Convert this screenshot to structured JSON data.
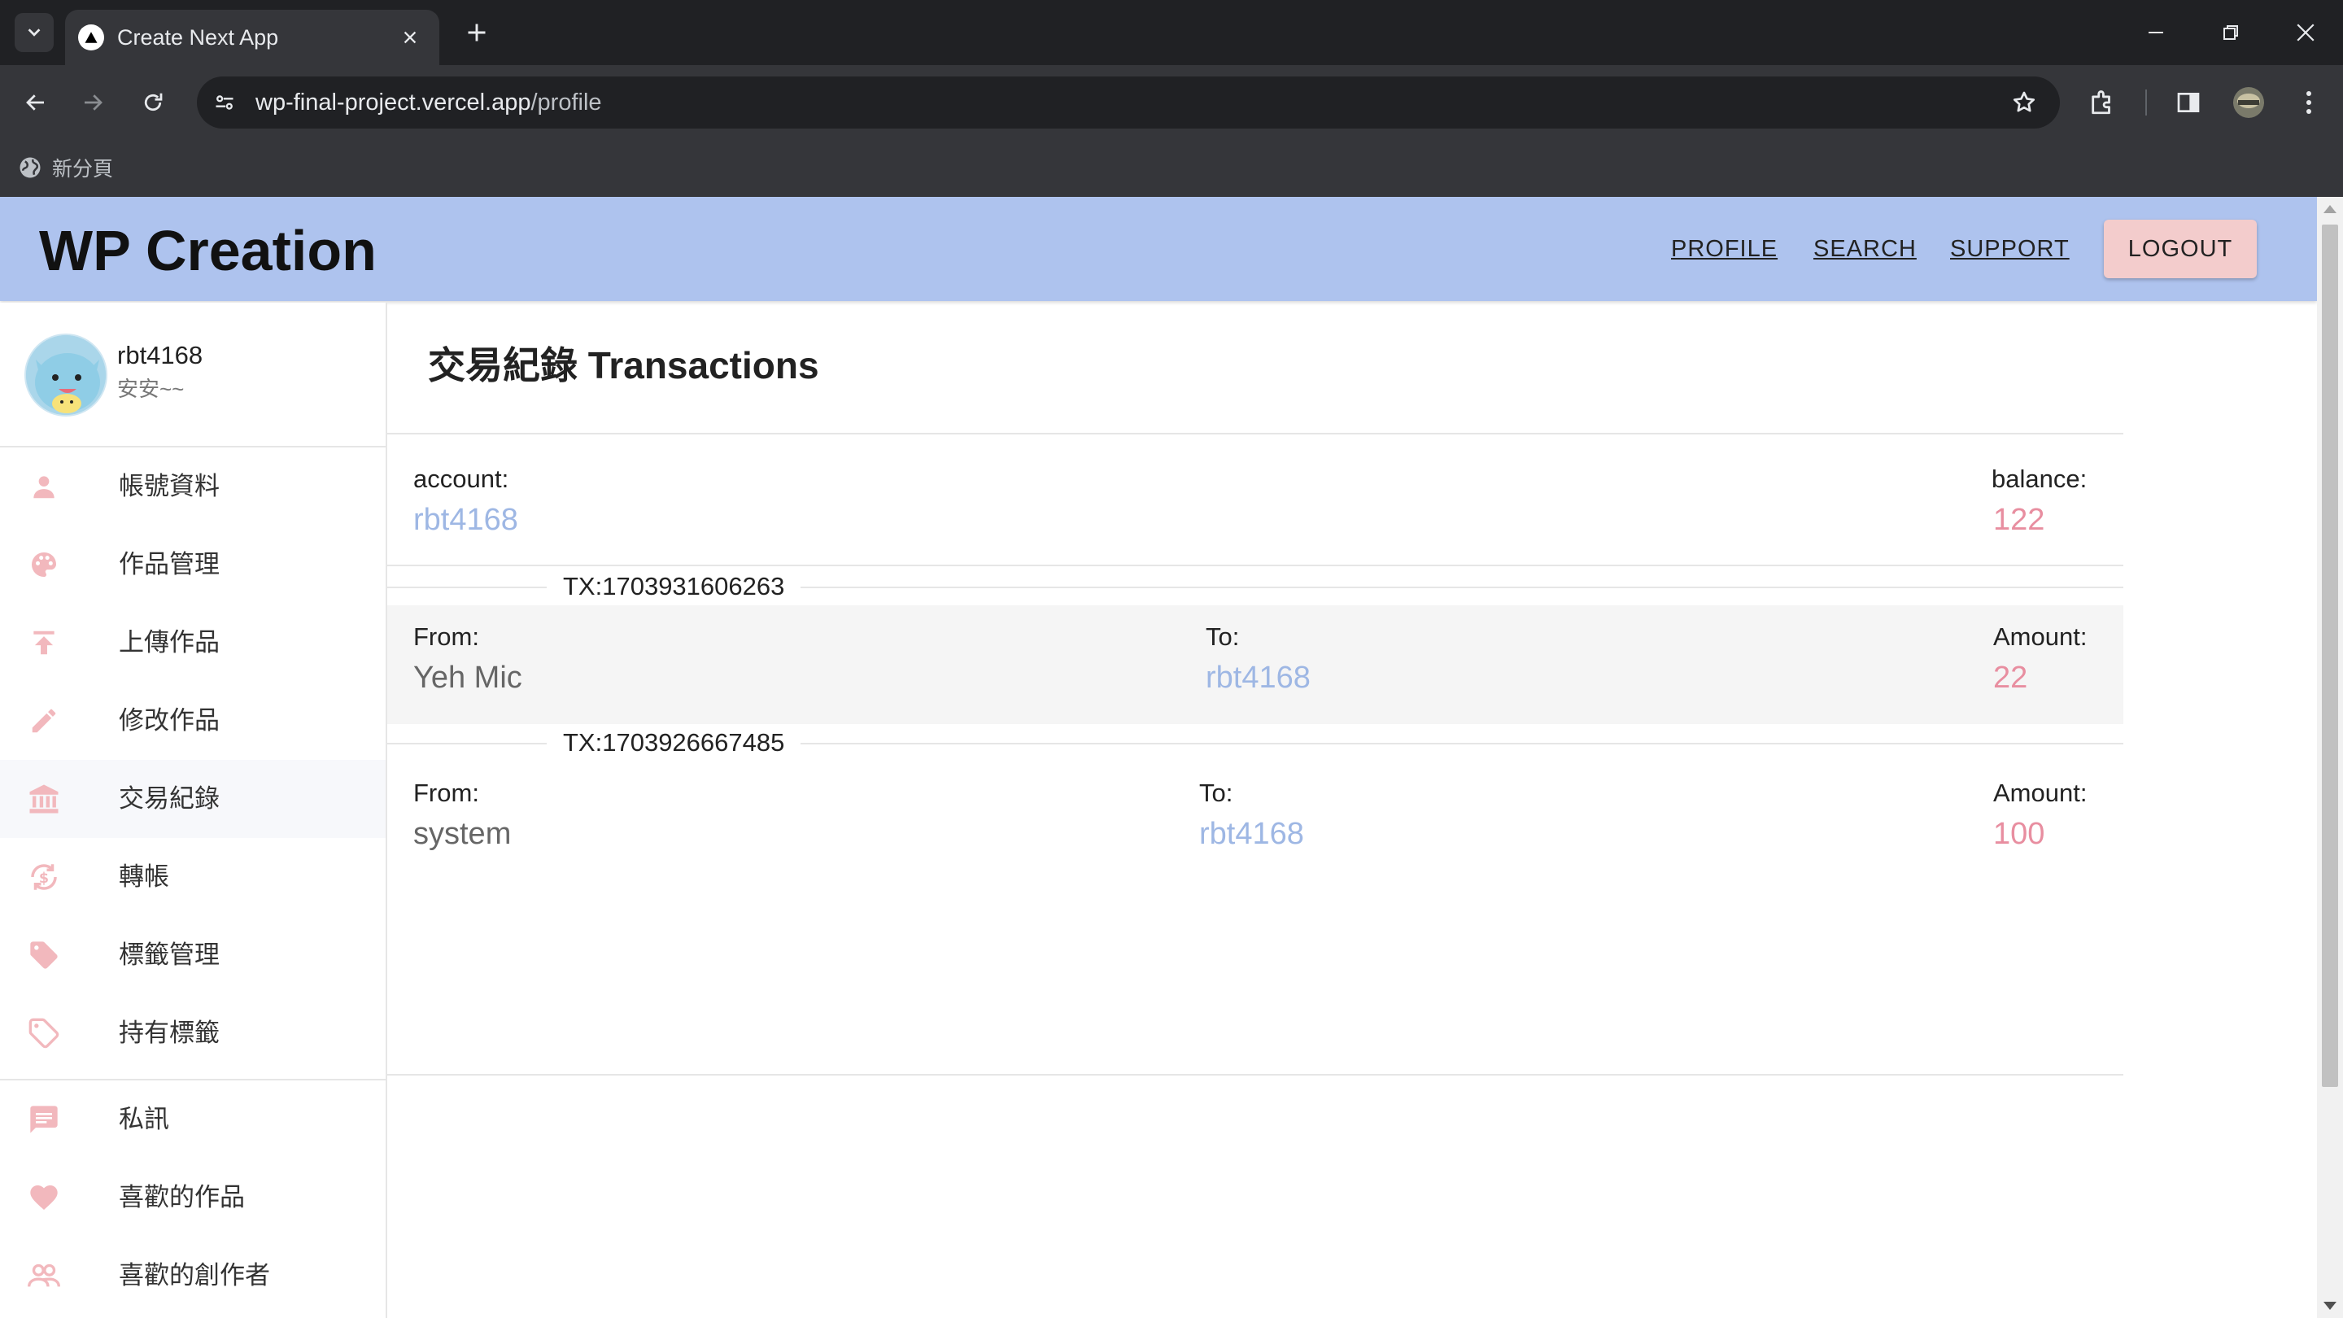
{
  "browser": {
    "tab_title": "Create Next App",
    "url_host": "wp-final-project.vercel.app",
    "url_path": "/profile",
    "bookmark_label": "新分頁"
  },
  "header": {
    "brand": "WP Creation",
    "nav": [
      "PROFILE",
      "SEARCH",
      "SUPPORT"
    ],
    "logout_label": "LOGOUT"
  },
  "user": {
    "name": "rbt4168",
    "motto": "安安~~"
  },
  "sidebar": {
    "items": [
      {
        "label": "帳號資料",
        "icon": "person-icon"
      },
      {
        "label": "作品管理",
        "icon": "palette-icon"
      },
      {
        "label": "上傳作品",
        "icon": "upload-icon"
      },
      {
        "label": "修改作品",
        "icon": "pencil-icon"
      },
      {
        "label": "交易紀錄",
        "icon": "bank-icon",
        "active": true
      },
      {
        "label": "轉帳",
        "icon": "currency-exchange-icon"
      },
      {
        "label": "標籤管理",
        "icon": "tag-icon"
      },
      {
        "label": "持有標籤",
        "icon": "tags-icon"
      },
      {
        "label": "私訊",
        "icon": "chat-icon"
      },
      {
        "label": "喜歡的作品",
        "icon": "heart-icon"
      },
      {
        "label": "喜歡的創作者",
        "icon": "people-icon"
      }
    ]
  },
  "transactions_page": {
    "title": "交易紀錄 Transactions",
    "account_label": "account:",
    "account_value": "rbt4168",
    "balance_label": "balance:",
    "balance_value": "122",
    "transactions": [
      {
        "id": "TX:1703931606263",
        "from_label": "From:",
        "from": "Yeh Mic",
        "to_label": "To:",
        "to": "rbt4168",
        "amount_label": "Amount:",
        "amount": "22"
      },
      {
        "id": "TX:1703926667485",
        "from_label": "From:",
        "from": "system",
        "to_label": "To:",
        "to": "rbt4168",
        "amount_label": "Amount:",
        "amount": "100"
      }
    ]
  },
  "colors": {
    "header_bg": "#aec3ee",
    "logout_bg": "#f3cccc",
    "link_blue": "#9eb7e4",
    "amount_pink": "#e88ea0",
    "icon_pink": "#f2b8bd"
  }
}
